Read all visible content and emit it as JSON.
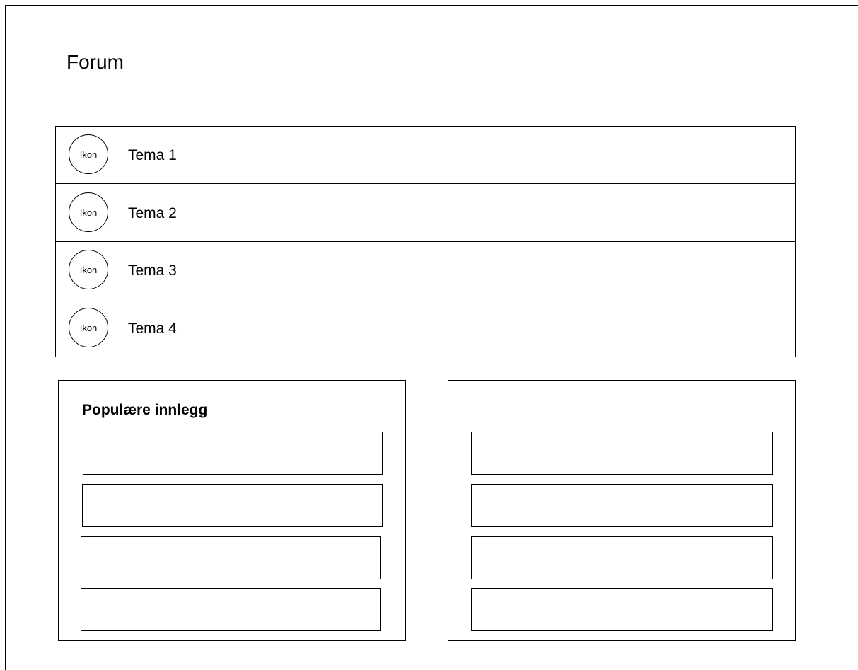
{
  "page": {
    "title": "Forum"
  },
  "topics": [
    {
      "icon_label": "Ikon",
      "label": "Tema 1"
    },
    {
      "icon_label": "Ikon",
      "label": "Tema 2"
    },
    {
      "icon_label": "Ikon",
      "label": "Tema 3"
    },
    {
      "icon_label": "Ikon",
      "label": "Tema 4"
    }
  ],
  "popular_posts": {
    "title": "Populære innlegg",
    "items": [
      "",
      "",
      "",
      ""
    ]
  },
  "second_panel": {
    "items": [
      "",
      "",
      "",
      ""
    ]
  }
}
